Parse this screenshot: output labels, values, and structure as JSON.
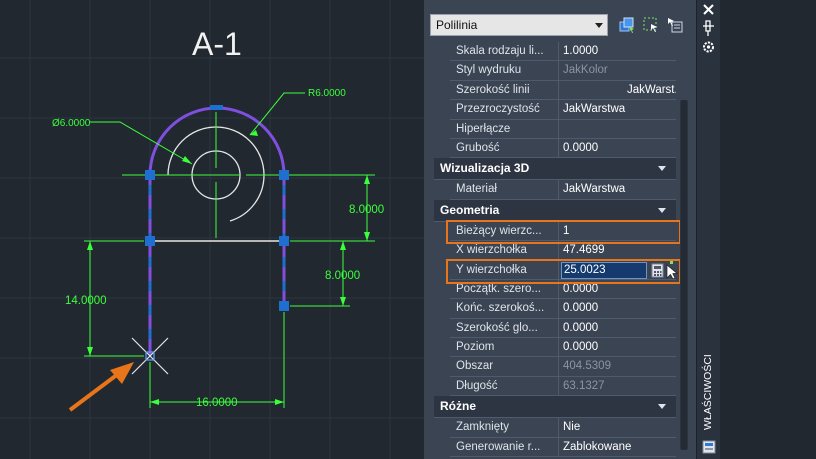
{
  "drawing": {
    "sheet_title": "A-1",
    "dims": {
      "r": "R6.0000",
      "dia": "Ø6.0000",
      "d1": "8.0000",
      "d2": "8.0000",
      "d3": "14.0000",
      "d4": "16.0000"
    }
  },
  "palette": {
    "object_type": "Polilinia",
    "toolbar_icons": [
      "quick-select-icon",
      "select-objects-icon",
      "toggle-pickadd-icon"
    ],
    "general": [
      {
        "name": "Skala rodzaju li...",
        "value": "1.0000"
      },
      {
        "name": "Styl wydruku",
        "value": "JakKolor"
      },
      {
        "name": "Szerokość linii",
        "value": "JakWarst..."
      },
      {
        "name": "Przezroczystość",
        "value": "JakWarstwa"
      },
      {
        "name": "Hiperłącze",
        "value": ""
      },
      {
        "name": "Grubość",
        "value": "0.0000"
      }
    ],
    "viz3d": {
      "title": "Wizualizacja 3D",
      "rows": [
        {
          "name": "Materiał",
          "value": "JakWarstwa"
        }
      ]
    },
    "geometry": {
      "title": "Geometria",
      "rows": [
        {
          "name": "Bieżący wierzc...",
          "value": "1"
        },
        {
          "name": "X wierzchołka",
          "value": "47.4699"
        },
        {
          "name": "Y wierzchołka",
          "value": "25.0023"
        },
        {
          "name": "Początk. szero...",
          "value": "0.0000"
        },
        {
          "name": "Końc. szerokoś...",
          "value": "0.0000"
        },
        {
          "name": "Szerokość glo...",
          "value": "0.0000"
        },
        {
          "name": "Poziom",
          "value": "0.0000"
        },
        {
          "name": "Obszar",
          "value": "404.5309"
        },
        {
          "name": "Długość",
          "value": "63.1327"
        }
      ]
    },
    "misc": {
      "title": "Różne",
      "rows": [
        {
          "name": "Zamknięty",
          "value": "Nie"
        },
        {
          "name": "Generowanie r...",
          "value": "Zablokowane"
        }
      ]
    },
    "side_label": "WŁAŚCIWOŚCI"
  },
  "colors": {
    "polyline": "#7f4fe0",
    "dimension": "#3cff3c",
    "grip": "#1f6fd1",
    "highlight": "#e8751a",
    "canvas": "#212830",
    "panel": "#3b4453"
  }
}
